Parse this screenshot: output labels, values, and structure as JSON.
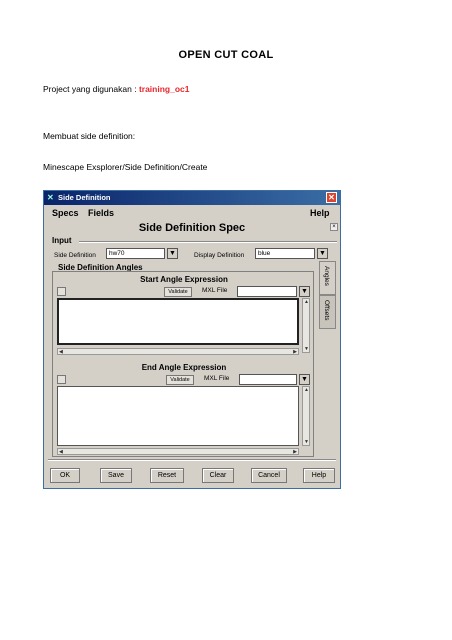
{
  "document": {
    "title": "OPEN CUT COAL",
    "project_label": "Project yang digunakan : ",
    "project_name": "training_oc1",
    "instruction": "Membuat side definition:",
    "menu_path": "Minescape Exsplorer/Side Definition/Create"
  },
  "window": {
    "title": "Side Definition",
    "close_glyph": "✕",
    "menu": {
      "specs": "Specs",
      "fields": "Fields",
      "help": "Help"
    },
    "spec_title": "Side Definition Spec",
    "input": {
      "section_label": "Input",
      "side_definition_label": "Side Definition",
      "side_definition_value": "hw70",
      "display_definition_label": "Display Definition",
      "display_definition_value": "blue"
    },
    "angles": {
      "section_label": "Side Definition Angles",
      "start": {
        "title": "Start Angle Expression",
        "validate": "Validate",
        "mxl_label": "MXL File",
        "mxl_value": ""
      },
      "end": {
        "title": "End Angle Expression",
        "validate": "Validate",
        "mxl_label": "MXL File",
        "mxl_value": ""
      }
    },
    "tabs": {
      "angles": "Angles",
      "offsets": "Offsets"
    },
    "buttons": {
      "ok": "OK",
      "save": "Save",
      "reset": "Reset",
      "clear": "Clear",
      "cancel": "Cancel",
      "help": "Help"
    }
  },
  "colors": {
    "accent_red": "#e8262b",
    "titlebar": "#0a246a",
    "window_bg": "#d4d0c8"
  }
}
